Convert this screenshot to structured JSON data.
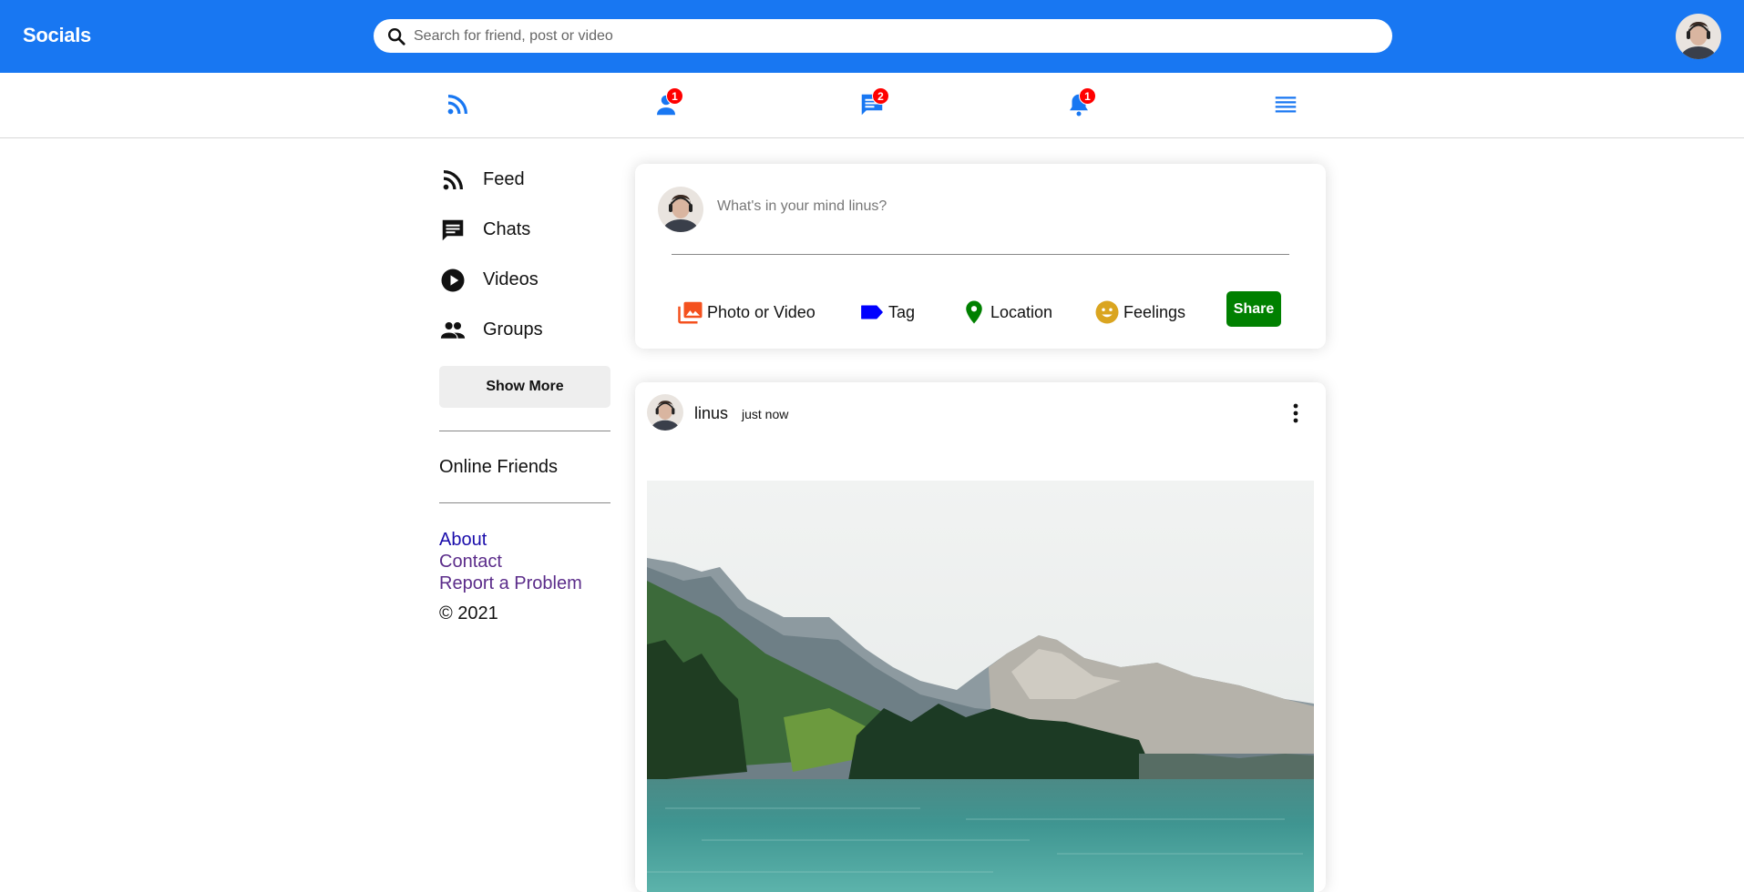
{
  "header": {
    "logo": "Socials",
    "search_placeholder": "Search for friend, post or video",
    "icons": {
      "search": "search-icon",
      "avatar": "user-avatar"
    }
  },
  "navbar": {
    "items": [
      {
        "icon": "rss-feed-icon",
        "badge": ""
      },
      {
        "icon": "person-icon",
        "badge": "1"
      },
      {
        "icon": "chat-icon",
        "badge": "2"
      },
      {
        "icon": "bell-icon",
        "badge": "1"
      },
      {
        "icon": "menu-lines-icon",
        "badge": ""
      }
    ],
    "accent": "#1877f2",
    "badge_color": "#ff0000"
  },
  "sidebar": {
    "items": [
      {
        "label": "Feed",
        "icon": "rss-feed-icon"
      },
      {
        "label": "Chats",
        "icon": "chat-icon"
      },
      {
        "label": "Videos",
        "icon": "play-circle-icon"
      },
      {
        "label": "Groups",
        "icon": "group-icon"
      }
    ],
    "show_more": "Show More",
    "online_friends": "Online Friends",
    "links": [
      "About",
      "Contact",
      "Report a Problem"
    ],
    "copyright": "© 2021"
  },
  "share": {
    "placeholder": "What's in your mind linus?",
    "options": [
      {
        "label": "Photo or Video",
        "icon": "photo-library-icon",
        "color": "#f4511e"
      },
      {
        "label": "Tag",
        "icon": "label-icon",
        "color": "#0000ff"
      },
      {
        "label": "Location",
        "icon": "location-pin-icon",
        "color": "#008000"
      },
      {
        "label": "Feelings",
        "icon": "emoji-icon",
        "color": "#daa520"
      }
    ],
    "button": "Share",
    "button_color": "#008000"
  },
  "post": {
    "username": "linus",
    "time": "just now",
    "image": "mountain-lake-photo"
  }
}
